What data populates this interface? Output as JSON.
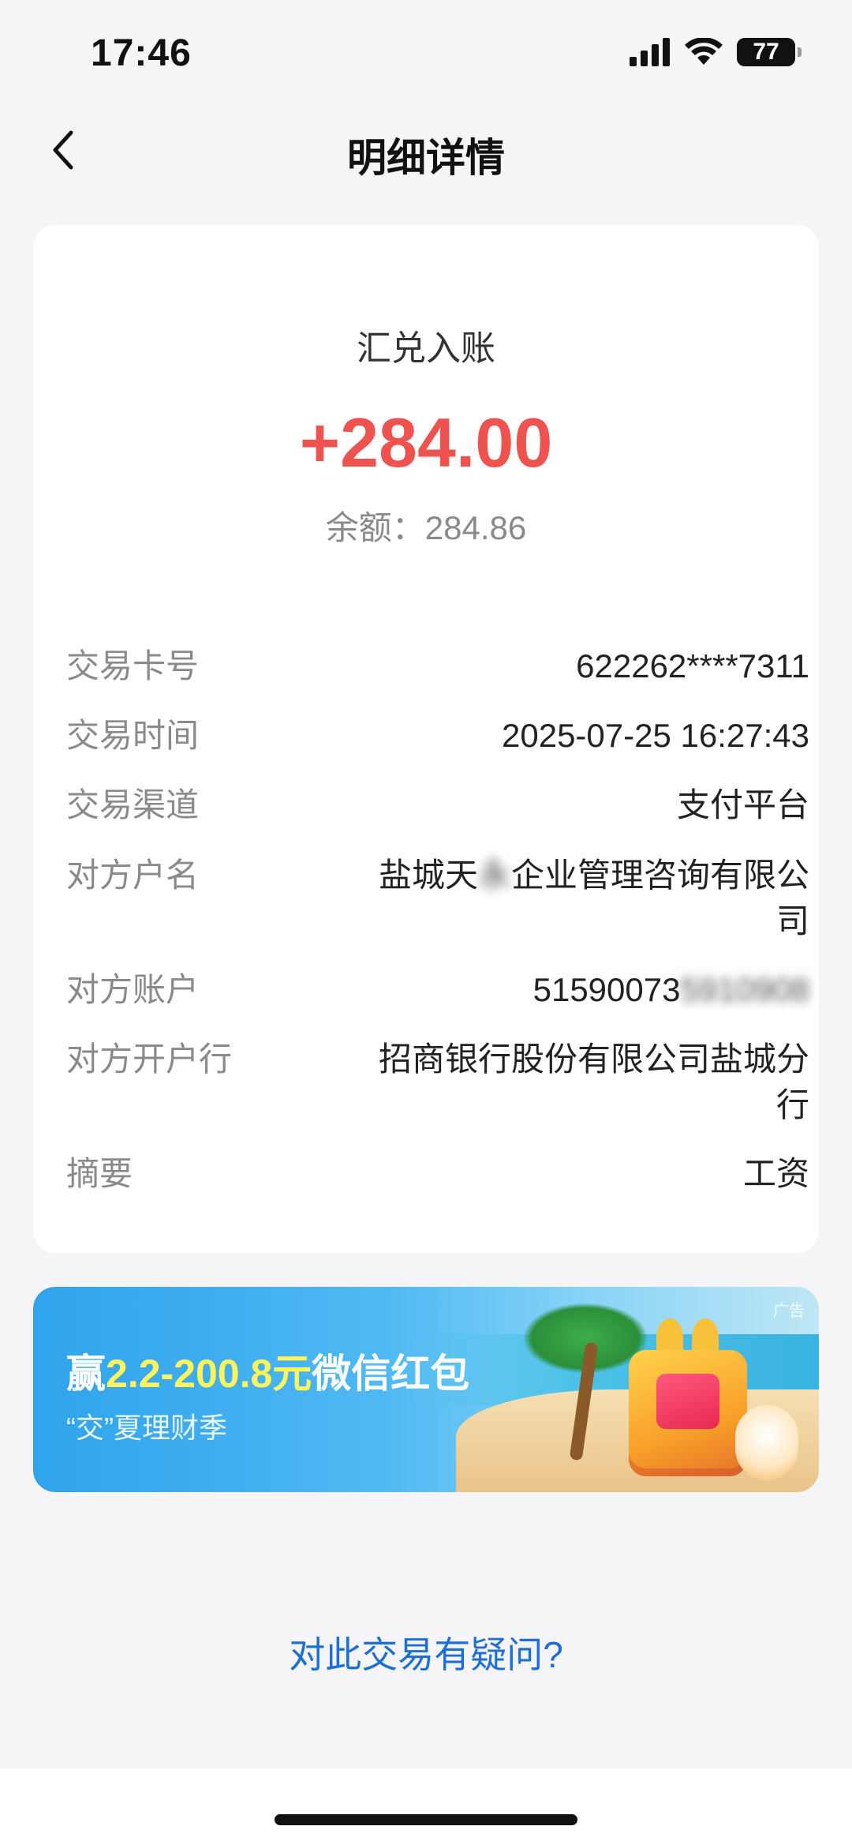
{
  "status_bar": {
    "time": "17:46",
    "battery": "77",
    "icons": [
      "signal-icon",
      "wifi-icon",
      "battery-icon"
    ]
  },
  "nav": {
    "title": "明细详情",
    "back_icon": "chevron-left-icon"
  },
  "summary": {
    "type": "汇兑入账",
    "amount": "+284.00",
    "balance": "余额：284.86",
    "amount_color": "#ef5350"
  },
  "details": [
    {
      "label": "交易卡号",
      "value": "622262****7311"
    },
    {
      "label": "交易时间",
      "value": "2025-07-25 16:27:43"
    },
    {
      "label": "交易渠道",
      "value": "支付平台"
    },
    {
      "label": "对方户名",
      "value_prefix": "盐城天",
      "value_hidden": "永",
      "value_suffix": "企业管理咨询有限公司"
    },
    {
      "label": "对方账户",
      "value_prefix": "51590073",
      "value_hidden": "5910908"
    },
    {
      "label": "对方开户行",
      "value": "招商银行股份有限公司盐城分行"
    },
    {
      "label": "摘要",
      "value": "工资"
    }
  ],
  "promo": {
    "title_prefix": "赢",
    "title_highlight": "2.2-200.8元",
    "title_suffix": "微信红包",
    "subtitle": "“交”夏理财季",
    "ad_tag": "广告"
  },
  "query_link": "对此交易有疑问?"
}
